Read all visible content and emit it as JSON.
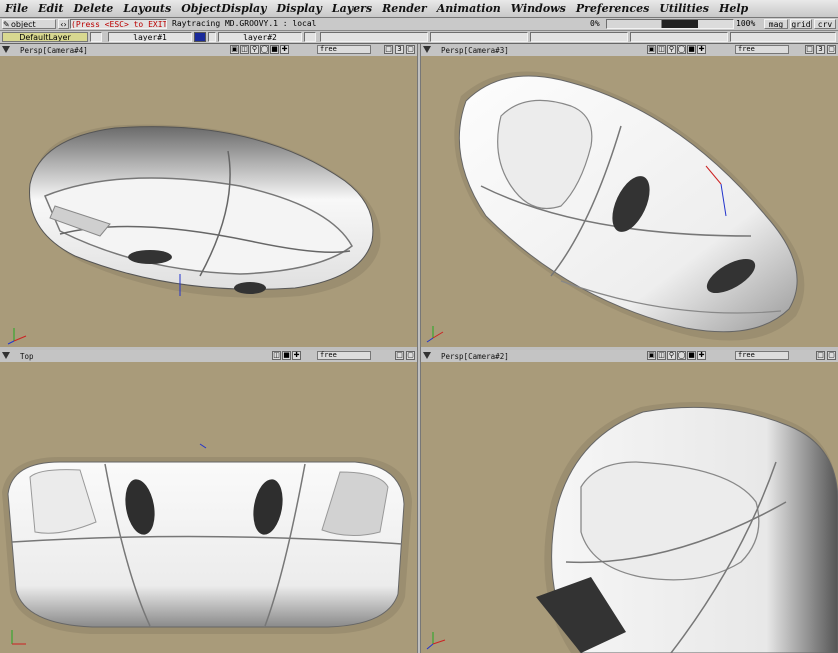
{
  "menu": [
    "File",
    "Edit",
    "Delete",
    "Layouts",
    "ObjectDisplay",
    "Display",
    "Layers",
    "Render",
    "Animation",
    "Windows",
    "Preferences",
    "Utilities",
    "Help"
  ],
  "toolbar": {
    "mode": "object",
    "message": "(Press <ESC> to EXIT",
    "status": "Raytracing MD.GROOVY.1 : local",
    "progress_start": "0%",
    "progress_end": "100%",
    "progress_fraction": 0.72,
    "buttons": [
      "mag",
      "grid",
      "crv"
    ]
  },
  "layers": {
    "default": "DefaultLayer",
    "layer1": "layer#1",
    "layer2": "layer#2"
  },
  "viewports": [
    {
      "id": "tl",
      "title": "Persp[Camera#4]",
      "mode": "free"
    },
    {
      "id": "tr",
      "title": "Persp[Camera#3]",
      "mode": "free"
    },
    {
      "id": "bl",
      "title": "Top",
      "mode": "free"
    },
    {
      "id": "br",
      "title": "Persp[Camera#2]",
      "mode": "free"
    }
  ],
  "icons": {
    "menu": "triangle-menu-icon",
    "pan": "pan-icon",
    "zoom": "zoom-icon",
    "zoom2": "zoom-region-icon",
    "tumble": "tumble-icon",
    "dolly": "dolly-icon",
    "track": "track-icon",
    "maximize": "maximize-icon",
    "number": "3",
    "axis": "axis-triad-icon"
  },
  "colors": {
    "background": "#a89a78",
    "model": "#f2f2f2",
    "accent_layer": "#1a2a9a"
  }
}
